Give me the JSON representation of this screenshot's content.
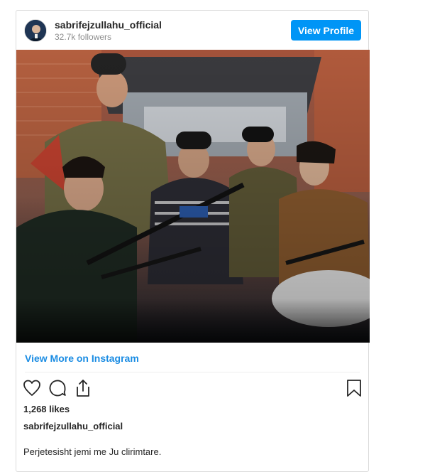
{
  "post": {
    "username": "sabrifejzullahu_official",
    "followers": "32.7k followers",
    "view_profile_label": "View Profile",
    "view_more_label": "View More on Instagram",
    "likes": "1,268 likes",
    "caption_username": "sabrifejzullahu_official",
    "caption_text": "Perjetesisht jemi me Ju clirimtare."
  },
  "colors": {
    "accent_button": "#0095f6",
    "link": "#1a8ce3",
    "border": "#dbdbdb",
    "muted_text": "#8e8e8e"
  },
  "icons": [
    "heart-icon",
    "comment-icon",
    "share-icon",
    "bookmark-icon"
  ]
}
